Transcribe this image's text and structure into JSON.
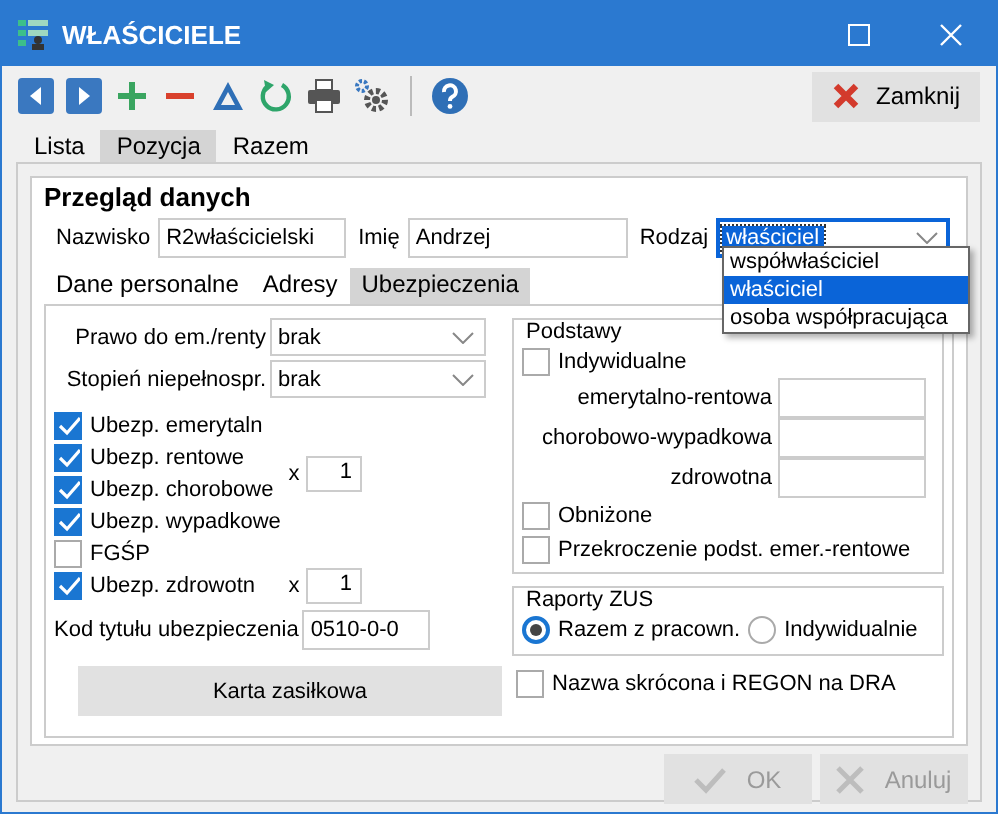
{
  "window": {
    "title": "WŁAŚCICIELE"
  },
  "toolbar": {
    "close_button": "Zamknij"
  },
  "tabs": [
    {
      "label": "Lista",
      "selected": false
    },
    {
      "label": "Pozycja",
      "selected": true
    },
    {
      "label": "Razem",
      "selected": false
    }
  ],
  "overview": {
    "title": "Przegląd danych",
    "fields": [
      {
        "label": "Nazwisko",
        "value": "R2właścicielski"
      },
      {
        "label": "Imię",
        "value": "Andrzej"
      }
    ],
    "type_select": {
      "label": "Rodzaj",
      "value": "właściciel",
      "expanded": true,
      "options": [
        {
          "label": "współwłaściciel",
          "selected": false
        },
        {
          "label": "właściciel",
          "selected": true
        },
        {
          "label": "osoba współpracująca",
          "selected": false
        }
      ]
    }
  },
  "subtabs": [
    {
      "label": "Dane personalne",
      "selected": false
    },
    {
      "label": "Adresy",
      "selected": false
    },
    {
      "label": "Ubezpieczenia",
      "selected": true
    }
  ],
  "insurance": {
    "selects": [
      {
        "label": "Prawo do em./renty",
        "value": "brak"
      },
      {
        "label": "Stopień niepełnospr.",
        "value": "brak"
      }
    ],
    "checks": [
      {
        "label": "Ubezp. emerytaln",
        "checked": true
      },
      {
        "label": "Ubezp. rentowe",
        "checked": true
      },
      {
        "label": "Ubezp. chorobowe",
        "checked": true
      },
      {
        "label": "Ubezp. wypadkowe",
        "checked": true
      },
      {
        "label": "FGŚP",
        "checked": false
      },
      {
        "label": "Ubezp. zdrowotn",
        "checked": true
      }
    ],
    "multipliers": [
      {
        "label": "x",
        "value": "1"
      },
      {
        "label": "x",
        "value": "1"
      }
    ],
    "code": {
      "label": "Kod tytułu ubezpieczenia",
      "value": "0510-0-0"
    },
    "benefit_button": "Karta zasiłkowa"
  },
  "bases": {
    "title": "Podstawy",
    "individual": {
      "label": "Indywidualne",
      "checked": false
    },
    "amounts": [
      {
        "label": "emerytalno-rentowa"
      },
      {
        "label": "chorobowo-wypadkowa"
      },
      {
        "label": "zdrowotna"
      }
    ],
    "reduced": {
      "label": "Obniżone",
      "checked": false
    },
    "exceed": {
      "label": "Przekroczenie podst. emer.-rentowe",
      "checked": false
    }
  },
  "zus_reports": {
    "title": "Raporty ZUS",
    "options": [
      {
        "label": "Razem z pracown.",
        "selected": true
      },
      {
        "label": "Indywidualnie",
        "selected": false
      }
    ]
  },
  "short_name": {
    "label": "Nazwa skrócona i REGON na DRA",
    "checked": false
  },
  "buttons": [
    {
      "kind": "ok",
      "label": "OK",
      "disabled": true
    },
    {
      "kind": "cancel",
      "label": "Anuluj",
      "disabled": true
    }
  ]
}
